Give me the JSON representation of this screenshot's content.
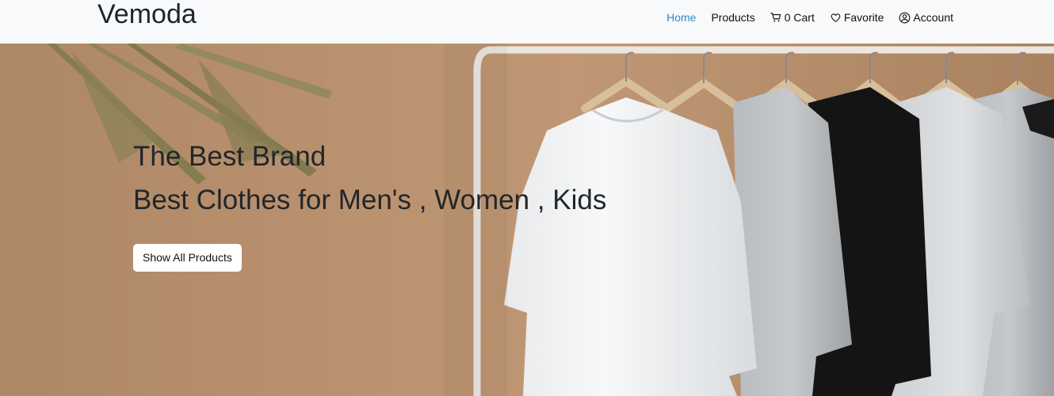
{
  "navbar": {
    "brand": "Vemoda",
    "links": [
      {
        "label": "Home",
        "icon": "",
        "active": true
      },
      {
        "label": "Products",
        "icon": "",
        "active": false
      },
      {
        "label": "0 Cart",
        "icon": "cart-icon",
        "active": false
      },
      {
        "label": "Favorite",
        "icon": "heart-icon",
        "active": false
      },
      {
        "label": "Account",
        "icon": "user-circle-icon",
        "active": false
      }
    ],
    "active_color": "#2f8bc2",
    "background": "#f8f9fa"
  },
  "hero": {
    "title": "The Best Brand",
    "subtitle": "Best Clothes for Men's , Women , Kids",
    "button_label": "Show All Products",
    "background_image": "t-shirts-on-hangers-rack"
  }
}
